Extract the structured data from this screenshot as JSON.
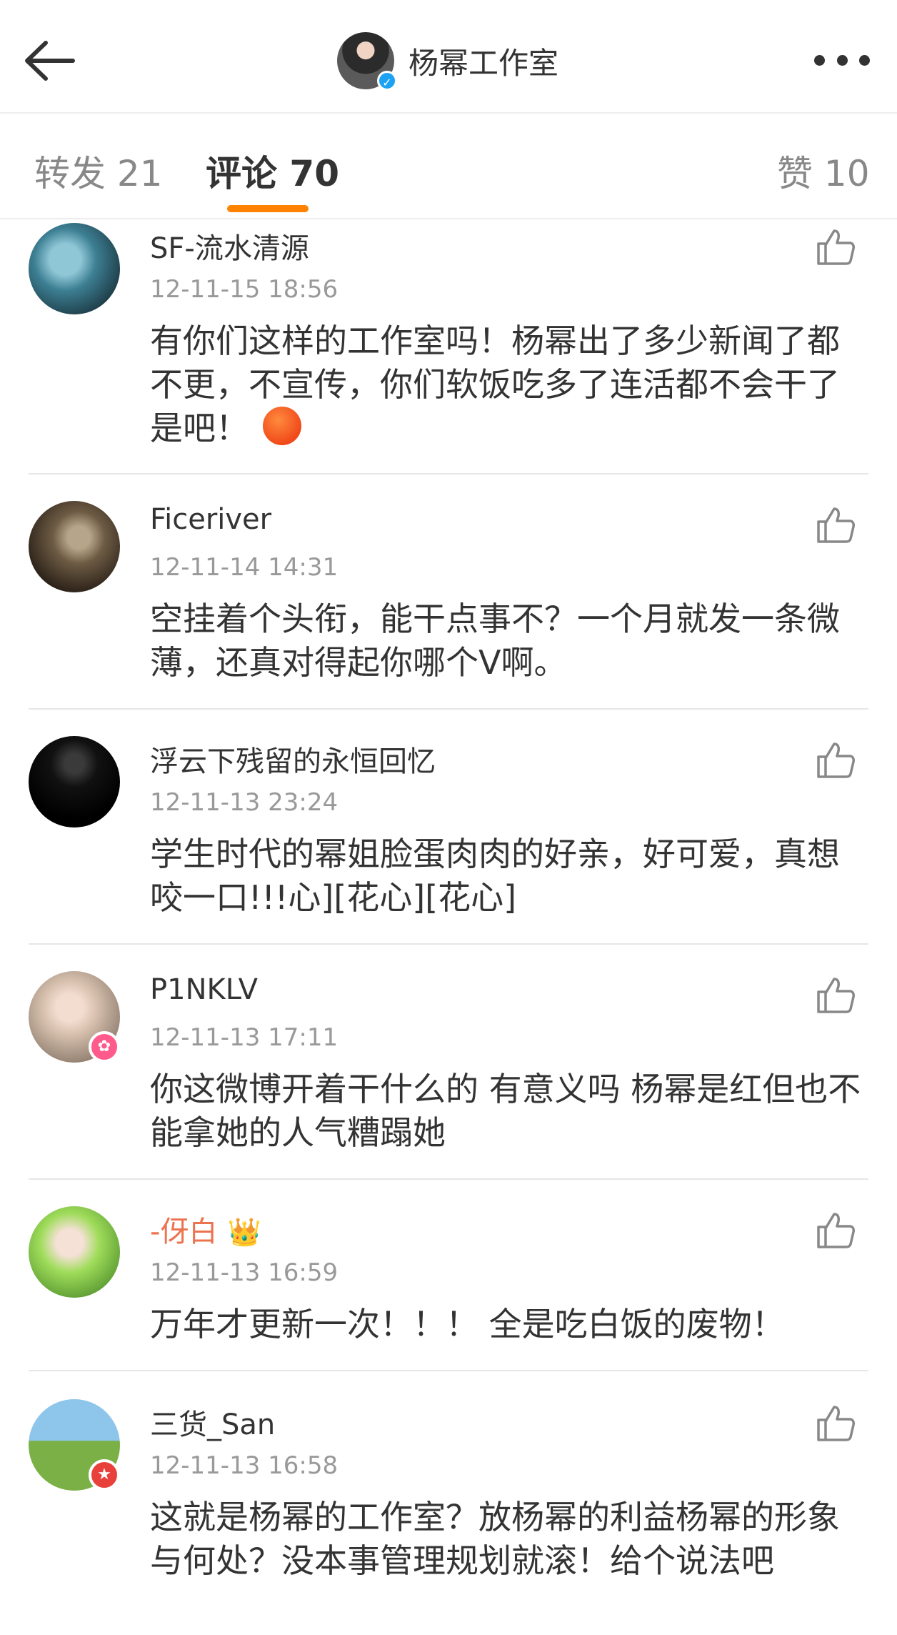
{
  "header": {
    "title": "杨幂工作室",
    "back_icon": "back-arrow-icon",
    "more_icon": "more-dots-icon",
    "verified_icon": "✓"
  },
  "tabs": [
    {
      "label": "转发 21",
      "active": false
    },
    {
      "label": "评论 70",
      "active": true
    },
    {
      "label": "赞 10",
      "active": false
    }
  ],
  "colors": {
    "accent": "#ff8200",
    "vip_name": "#eb7350",
    "text_primary": "#333333",
    "text_secondary": "#999999",
    "divider": "#e6e6e6"
  },
  "comments": [
    {
      "username": "SF-流水清源",
      "timestamp": "12-11-15 18:56",
      "content": "有你们这样的工作室吗！杨幂出了多少新闻了都不更，不宣传，你们软饭吃多了连活都不会干了是吧！",
      "emoji": "angry-emoji"
    },
    {
      "username": "Ficeriver",
      "timestamp": "12-11-14 14:31",
      "content": "空挂着个头衔，能干点事不？一个月就发一条微薄，还真对得起你哪个V啊。"
    },
    {
      "username": "浮云下残留的永恒回忆",
      "timestamp": "12-11-13 23:24",
      "content": "学生时代的幂姐脸蛋肉肉的好亲，好可爱，真想咬一口!!!心][花心][花心]"
    },
    {
      "username": "P1NKLV",
      "timestamp": "12-11-13 17:11",
      "content": "你这微博开着干什么的 有意义吗 杨幂是红但也不能拿她的人气糟蹋她",
      "badge_icon": "bunny-badge-icon"
    },
    {
      "username": "-伢白",
      "timestamp": "12-11-13 16:59",
      "content": "万年才更新一次！！！ 全是吃白饭的废物！",
      "vip": true,
      "crown_icon": "👑"
    },
    {
      "username": "三货_San",
      "timestamp": "12-11-13 16:58",
      "content": "这就是杨幂的工作室？放杨幂的利益杨幂的形象与何处？没本事管理规划就滚！给个说法吧",
      "badge_icon": "star-badge-icon"
    }
  ]
}
